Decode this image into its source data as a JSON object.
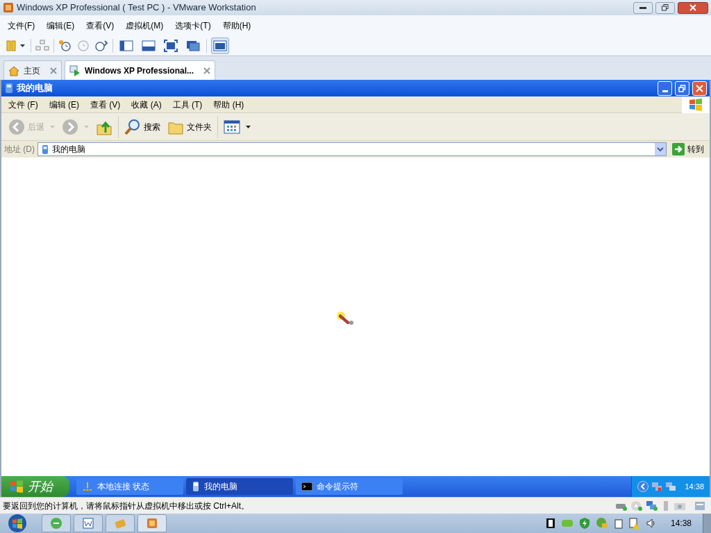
{
  "window": {
    "title": "Windows XP Professional ( Test PC ) - VMware Workstation"
  },
  "menu": [
    "文件(F)",
    "编辑(E)",
    "查看(V)",
    "虚拟机(M)",
    "选项卡(T)",
    "帮助(H)"
  ],
  "view_buttons": [
    {
      "selected": false
    },
    {
      "selected": false
    },
    {
      "selected": false
    },
    {
      "selected": false
    },
    {
      "selected": true
    }
  ],
  "tabs": [
    {
      "label": "主页",
      "selected": false
    },
    {
      "label": "Windows XP Professional...",
      "selected": true
    }
  ],
  "guest": {
    "window": {
      "title": "我的电脑"
    },
    "menu": [
      "文件 (F)",
      "编辑 (E)",
      "查看 (V)",
      "收藏 (A)",
      "工具 (T)",
      "帮助 (H)"
    ],
    "toolbar": [
      {
        "kind": "back",
        "label": "后退",
        "disabled": true
      },
      {
        "kind": "forward",
        "disabled": true
      },
      {
        "kind": "up"
      },
      {
        "kind": "search",
        "label": "搜索"
      },
      {
        "kind": "folders",
        "label": "文件夹"
      },
      {
        "kind": "views"
      }
    ],
    "address": {
      "label": "地址 (D)",
      "value": "我的电脑",
      "go": "转到"
    },
    "taskbar": {
      "start": "开始",
      "tasks": [
        {
          "kind": "network",
          "label": "本地连接 状态",
          "selected": false
        },
        {
          "kind": "computer",
          "label": "我的电脑",
          "selected": true
        },
        {
          "kind": "console",
          "label": "命令提示符",
          "selected": false
        }
      ],
      "clock": "14:38"
    }
  },
  "status_bar": {
    "message": "要返回到您的计算机，请将鼠标指针从虚拟机中移出或按 Ctrl+Alt。"
  },
  "host_taskbar": {
    "clock": "14:38"
  }
}
